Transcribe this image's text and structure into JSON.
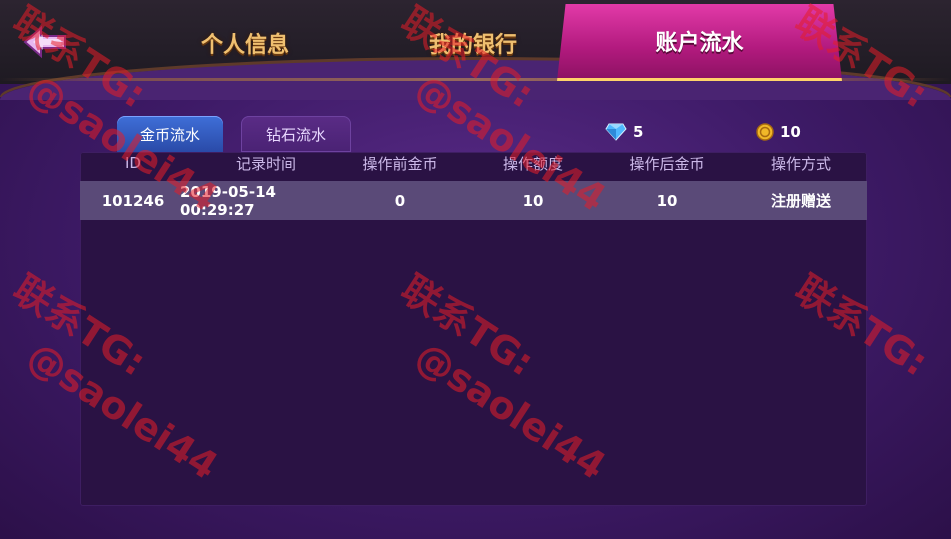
{
  "header": {
    "tabs": [
      {
        "label": "个人信息",
        "active": false
      },
      {
        "label": "我的银行",
        "active": false
      },
      {
        "label": "账户流水",
        "active": true
      }
    ]
  },
  "sub_tabs": [
    {
      "label": "金币流水",
      "active": true
    },
    {
      "label": "钻石流水",
      "active": false
    }
  ],
  "balances": {
    "diamond": "5",
    "gold": "10",
    "diamond_icon": "diamond-icon",
    "gold_icon": "gold-coin-icon"
  },
  "table": {
    "columns": [
      "ID",
      "记录时间",
      "操作前金币",
      "操作额度",
      "操作后金币",
      "操作方式"
    ],
    "rows": [
      [
        "101246",
        "2019-05-14 00:29:27",
        "0",
        "10",
        "10",
        "注册赠送"
      ]
    ]
  },
  "watermark": {
    "line1": "联系TG:",
    "line2": "@saolei44"
  },
  "colors": {
    "accent_pink": "#c8248e",
    "tab_blue": "#3a66cc",
    "gold_text": "#f0c070",
    "watermark_red": "#e61e28"
  }
}
